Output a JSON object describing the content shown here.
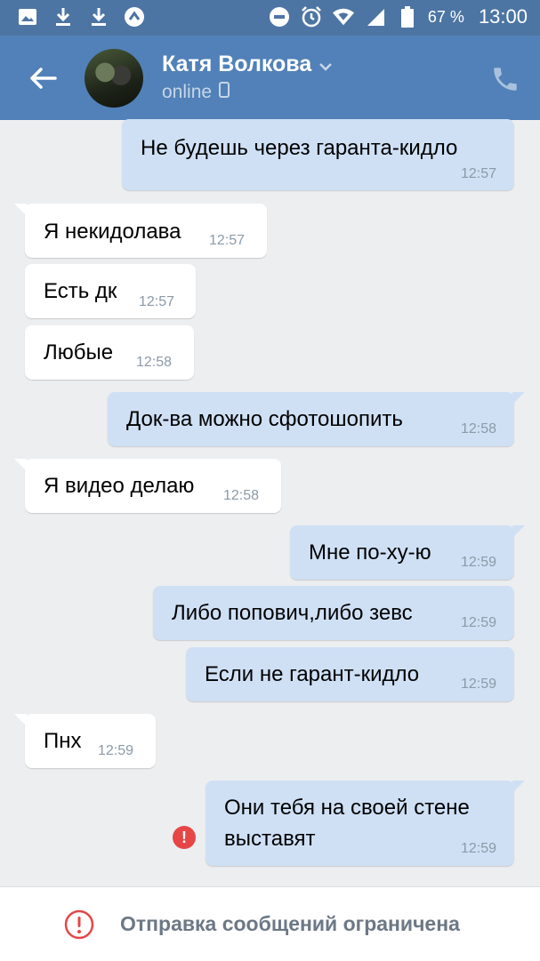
{
  "status_bar": {
    "icons_left": [
      "image-icon",
      "download-icon",
      "download-icon",
      "vpn-icon"
    ],
    "icons_right": [
      "dnd-icon",
      "alarm-icon",
      "wifi-icon",
      "signal-icon",
      "battery-icon"
    ],
    "battery": "67 %",
    "time": "13:00"
  },
  "header": {
    "name": "Катя Волкова",
    "status": "online"
  },
  "messages": [
    {
      "dir": "out",
      "text": "Не будешь через гаранта-кидло",
      "time": "12:57"
    },
    {
      "dir": "in",
      "text": "Я некидолава",
      "time": "12:57"
    },
    {
      "dir": "in",
      "text": "Есть дк",
      "time": "12:57"
    },
    {
      "dir": "in",
      "text": "Любые",
      "time": "12:58"
    },
    {
      "dir": "out",
      "text": "Док-ва можно сфотошопить",
      "time": "12:58"
    },
    {
      "dir": "in",
      "text": "Я видео делаю",
      "time": "12:58"
    },
    {
      "dir": "out",
      "text": "Мне по-ху-ю",
      "time": "12:59"
    },
    {
      "dir": "out",
      "text": "Либо попович,либо зевс",
      "time": "12:59"
    },
    {
      "dir": "out",
      "text": "Если не гарант-кидло",
      "time": "12:59"
    },
    {
      "dir": "in",
      "text": "Пнх",
      "time": "12:59"
    },
    {
      "dir": "out",
      "text": "Они тебя на своей стене",
      "text2": "выставят",
      "time": "12:59",
      "failed": true
    }
  ],
  "bottom_bar": {
    "notice": "Отправка сообщений ограничена"
  },
  "colors": {
    "header": "#5181b8",
    "status_bar": "#4d75a3",
    "outgoing_bubble": "#cfe0f5",
    "incoming_bubble": "#ffffff",
    "error": "#e64646"
  }
}
